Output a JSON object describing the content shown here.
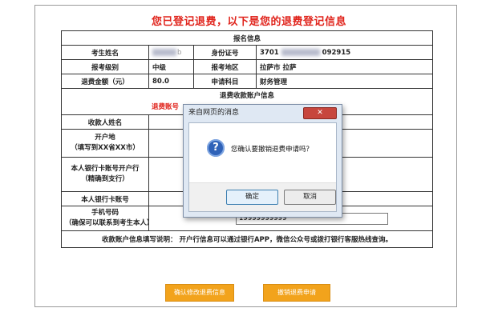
{
  "page_title": "您已登记退费，以下是您的退费登记信息",
  "sections": {
    "registration": "报名信息",
    "account": "退费收款账户信息"
  },
  "registration": {
    "name_label": "考生姓名",
    "name_value_suffix": "b",
    "id_label": "身份证号",
    "id_prefix": "3701",
    "id_suffix": "092915",
    "level_label": "报考级别",
    "level_value": "中级",
    "region_label": "报考地区",
    "region_value": "拉萨市 拉萨",
    "amount_label": "退费金额（元）",
    "amount_value": "80.0",
    "subject_label": "申请科目",
    "subject_value": "财务管理"
  },
  "account": {
    "refund_account_label": "退费账号",
    "payee_label": "收款人姓名",
    "bank_location_label_1": "开户地",
    "bank_location_label_2": "（填写到XX省XX市）",
    "bank_branch_label_1": "本人银行卡账号开户行",
    "bank_branch_label_2": "（精确到支行）",
    "card_number_label": "本人银行卡账号",
    "phone_label_1": "手机号码",
    "phone_label_2": "（确保可以联系到考生本人）",
    "phone_value": "19999999999",
    "note": "收款账户信息填写说明： 开户行信息可以通过银行APP，微信公众号或拨打银行客服热线查询。",
    "select_glyph": "× ▾"
  },
  "buttons": {
    "confirm_modify": "确认修改退费信息",
    "cancel_refund": "撤销退费申请"
  },
  "dialog": {
    "title": "来自网页的消息",
    "close": "✕",
    "message": "您确认要撤销退费申请吗？",
    "ok": "确定",
    "cancel": "取消"
  }
}
